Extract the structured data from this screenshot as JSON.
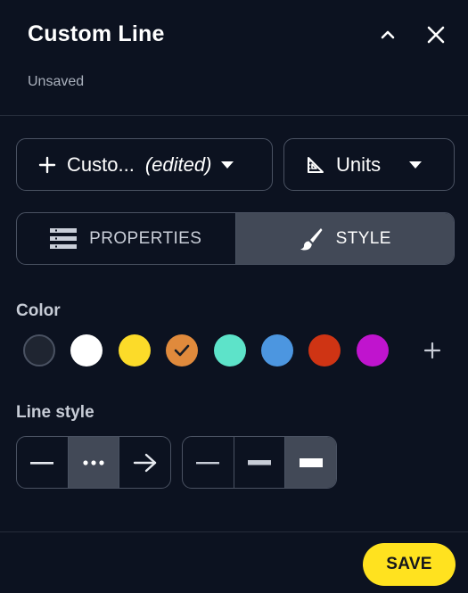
{
  "header": {
    "title": "Custom Line",
    "status": "Unsaved",
    "collapse_icon": "chevron-up-icon",
    "close_icon": "close-icon"
  },
  "selectors": {
    "line_template": {
      "icon": "plus-icon",
      "label": "Custo...",
      "edited": "(edited)"
    },
    "units": {
      "icon": "set-square-icon",
      "label": "Units"
    }
  },
  "tabs": [
    {
      "label": "PROPERTIES",
      "icon": "list-icon",
      "active": false
    },
    {
      "label": "STYLE",
      "icon": "paintbrush-icon",
      "active": true
    }
  ],
  "color": {
    "label": "Color",
    "swatches": [
      {
        "hex": "#1f2531",
        "selected": false
      },
      {
        "hex": "#ffffff",
        "selected": false
      },
      {
        "hex": "#fcdb29",
        "selected": false
      },
      {
        "hex": "#e08a3c",
        "selected": true
      },
      {
        "hex": "#5de3c9",
        "selected": false
      },
      {
        "hex": "#4c96e0",
        "selected": false
      },
      {
        "hex": "#cf3414",
        "selected": false
      },
      {
        "hex": "#c014ce",
        "selected": false
      }
    ],
    "add_icon": "plus-icon"
  },
  "line_style": {
    "label": "Line style",
    "pattern_options": [
      {
        "name": "solid",
        "icon": "solid-line-icon",
        "selected": false
      },
      {
        "name": "dotted",
        "icon": "dotted-line-icon",
        "selected": true
      },
      {
        "name": "arrow",
        "icon": "arrow-right-icon",
        "selected": false
      }
    ],
    "width_options": [
      {
        "name": "thin",
        "icon": "thin-line-icon",
        "selected": false
      },
      {
        "name": "medium",
        "icon": "medium-line-icon",
        "selected": false
      },
      {
        "name": "thick",
        "icon": "thick-line-icon",
        "selected": true
      }
    ]
  },
  "footer": {
    "save_label": "SAVE"
  },
  "theme": {
    "accent": "#ffe21f",
    "background": "#0c1220",
    "selected_segment": "#424957"
  }
}
